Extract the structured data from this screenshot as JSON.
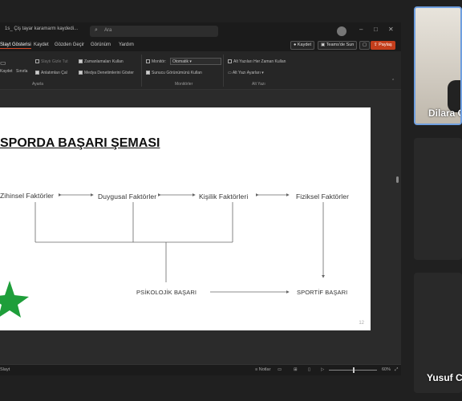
{
  "window": {
    "title": "1s_ Çiş tayar karamarm kaydedi...",
    "search_placeholder": "Ara"
  },
  "ribbon_tabs": [
    "Slayt Gösterisi",
    "Kaydet",
    "Gözden Geçir",
    "Görünüm",
    "Yardım"
  ],
  "ribbon_buttons": {
    "record": "Kaydet",
    "present_teams": "Teams'de Sun",
    "share": "Paylaş"
  },
  "ribbon": {
    "group1_btn1": "Kaydet",
    "group1_btn2": "Sınırla",
    "opt_hide": "Slaytı Gizle Tut",
    "opt_timings": "Zamanlamaları Kullan",
    "opt_narration": "Anlatımları Çal",
    "opt_media": "Medya Denetimlerini Göster",
    "group1_label": "Ayarla",
    "monitor_label": "Monitör:",
    "monitor_value": "Otomatik",
    "presenter_view": "Sunucu Görünümünü Kullan",
    "group2_label": "Monitörler",
    "subtitles_always": "Alt Yazıları Her Zaman Kullan",
    "subtitle_settings": "Alt Yazı Ayarları",
    "group3_label": "Alt Yazı"
  },
  "slide": {
    "title": "SPORDA BAŞARI ŞEMASI",
    "nodes": {
      "zihinsel": "Zihinsel Faktörler",
      "duygusal": "Duygusal Faktörler",
      "kisilik": "Kişilik Faktörleri",
      "fiziksel": "Fiziksel Faktörler",
      "psikolojik": "PSİKOLOJİK BAŞARI",
      "sportif": "SPORTİF BAŞARI"
    },
    "number": "12"
  },
  "status": {
    "left": "Slayt",
    "notes": "Notlar",
    "zoom": "60%"
  },
  "participants": [
    {
      "name": "Dilara C"
    },
    {
      "name": ""
    },
    {
      "name": "Yusuf C"
    }
  ],
  "colors": {
    "star": "#1e9e3a",
    "share_accent": "#c43e1c",
    "active_speaker_border": "#6f9fe0"
  }
}
